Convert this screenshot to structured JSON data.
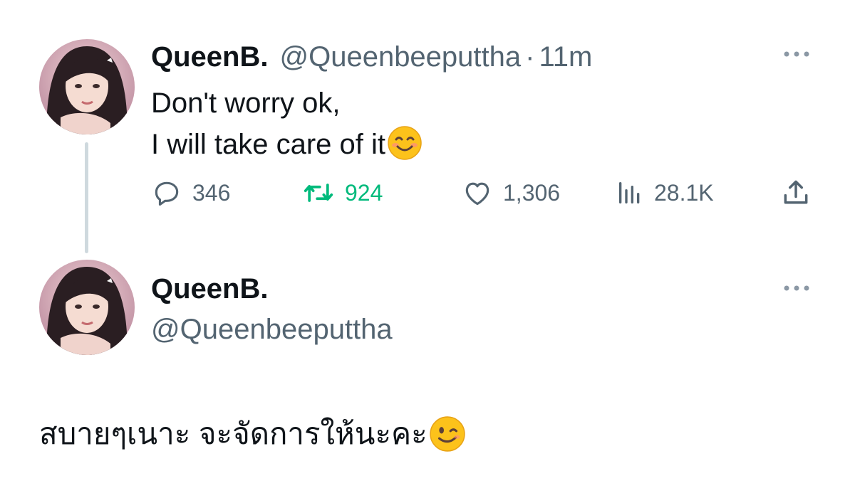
{
  "thread": {
    "tweet1": {
      "display_name": "QueenB.",
      "handle": "@Queenbeeputtha",
      "separator": "·",
      "time": "11m",
      "text_line1": "Don't worry ok,",
      "text_line2": "I will take care of it",
      "emoji": "smiling-face-icon",
      "actions": {
        "replies": "346",
        "retweets": "924",
        "likes": "1,306",
        "views": "28.1K"
      }
    },
    "tweet2": {
      "display_name": "QueenB.",
      "handle": "@Queenbeeputtha",
      "text": "สบายๆเนาะ จะจัดการให้นะคะ",
      "emoji": "winking-face-icon"
    }
  },
  "colors": {
    "text": "#0f1419",
    "secondary": "#536471",
    "retweet_active": "#00ba7c",
    "thread_line": "#cfd9de"
  }
}
